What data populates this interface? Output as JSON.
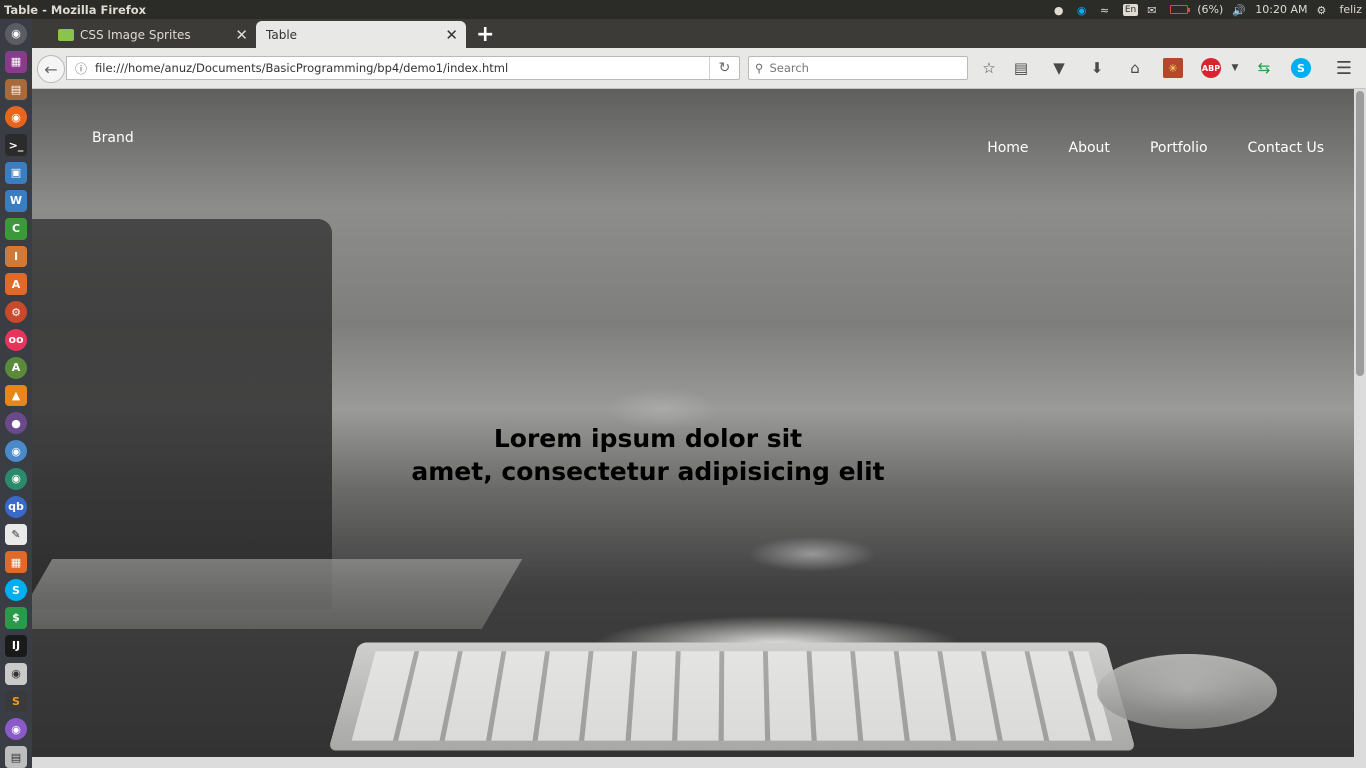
{
  "system": {
    "window_title": "Table - Mozilla Firefox",
    "battery_text": "(6%)",
    "time": "10:20 AM",
    "user": "feliz",
    "keyboard_layout": "En"
  },
  "launcher": {
    "items": [
      "dash",
      "workspace",
      "files",
      "firefox",
      "terminal",
      "virtualbox",
      "writer",
      "calc",
      "impress",
      "software-center",
      "settings",
      "flickr",
      "android-studio",
      "vlc",
      "tor",
      "chromium",
      "color-picker",
      "qbittorrent",
      "text-editor",
      "scanner",
      "skype",
      "money",
      "intellij",
      "screenshot",
      "sublime",
      "emblem",
      "storage"
    ]
  },
  "tabs": [
    {
      "label": "CSS Image Sprites",
      "active": false
    },
    {
      "label": "Table",
      "active": true
    }
  ],
  "navbar": {
    "url": "file:///home/anuz/Documents/BasicProgramming/bp4/demo1/index.html",
    "search_placeholder": "Search"
  },
  "page": {
    "brand": "Brand",
    "nav": [
      "Home",
      "About",
      "Portfolio",
      "Contact Us"
    ],
    "headline_line1": "Lorem ipsum dolor sit",
    "headline_line2": "amet, consectetur adipisicing elit"
  },
  "colors": {
    "accent_abp": "#d9232f",
    "skype": "#00aff0",
    "favicon": "#8ac44d"
  }
}
